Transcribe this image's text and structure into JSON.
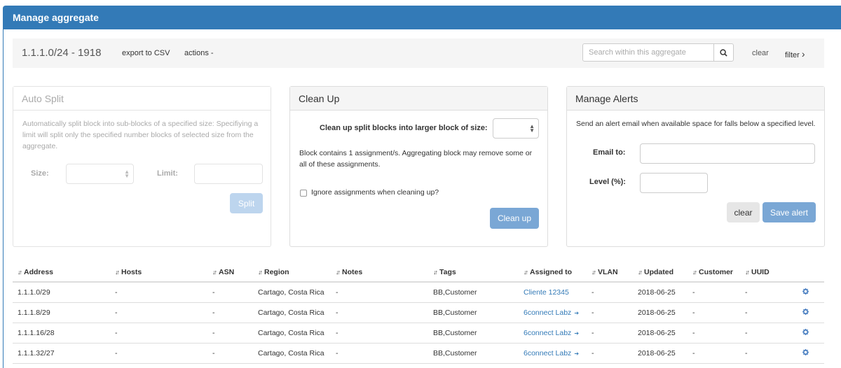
{
  "panel": {
    "title": "Manage aggregate"
  },
  "toolbar": {
    "aggregate": "1.1.1.0/24 - 1918",
    "export_label": "export to CSV",
    "actions_label": "actions -",
    "search_placeholder": "Search within this aggregate",
    "clear_label": "clear",
    "filter_label": "filter",
    "filter_icon": "›"
  },
  "auto_split": {
    "title": "Auto Split",
    "description": "Automatically split block into sub-blocks of a specified size: Specifiying a limit will split only the specified number blocks of selected size from the aggregate.",
    "size_label": "Size:",
    "limit_label": "Limit:",
    "split_label": "Split"
  },
  "clean_up": {
    "title": "Clean Up",
    "instruction": "Clean up split blocks into larger block of size:",
    "info": "Block contains 1 assignment/s. Aggregating block may remove some or all of these assignments.",
    "ignore_label": "Ignore assignments when cleaning up?",
    "button_label": "Clean up"
  },
  "alerts": {
    "title": "Manage Alerts",
    "description": "Send an alert email when available space for falls below a specified level.",
    "email_label": "Email to:",
    "level_label": "Level (%):",
    "clear_label": "clear",
    "save_label": "Save alert"
  },
  "table": {
    "sort_icon": "↓↑",
    "columns": [
      "Address",
      "Hosts",
      "ASN",
      "Region",
      "Notes",
      "Tags",
      "Assigned to",
      "VLAN",
      "Updated",
      "Customer",
      "UUID"
    ],
    "rows": [
      {
        "address": "1.1.1.0/29",
        "hosts": "-",
        "asn": "-",
        "region": "Cartago, Costa Rica",
        "notes": "-",
        "tags": "BB,Customer",
        "assigned": "Cliente 12345",
        "assigned_arrow": "",
        "vlan": "-",
        "updated": "2018-06-25",
        "customer": "-",
        "uuid": "-"
      },
      {
        "address": "1.1.1.8/29",
        "hosts": "-",
        "asn": "-",
        "region": "Cartago, Costa Rica",
        "notes": "-",
        "tags": "BB,Customer",
        "assigned": "6connect Labz",
        "assigned_arrow": "➔",
        "vlan": "-",
        "updated": "2018-06-25",
        "customer": "-",
        "uuid": "-"
      },
      {
        "address": "1.1.1.16/28",
        "hosts": "-",
        "asn": "-",
        "region": "Cartago, Costa Rica",
        "notes": "-",
        "tags": "BB,Customer",
        "assigned": "6connect Labz",
        "assigned_arrow": "➔",
        "vlan": "-",
        "updated": "2018-06-25",
        "customer": "-",
        "uuid": "-"
      },
      {
        "address": "1.1.1.32/27",
        "hosts": "-",
        "asn": "-",
        "region": "Cartago, Costa Rica",
        "notes": "-",
        "tags": "BB,Customer",
        "assigned": "6connect Labz",
        "assigned_arrow": "➔",
        "vlan": "-",
        "updated": "2018-06-25",
        "customer": "-",
        "uuid": "-"
      }
    ]
  },
  "colors": {
    "primary": "#337ab7",
    "button_primary": "#7aa7d5",
    "toolbar_bg": "#f5f5f5"
  }
}
